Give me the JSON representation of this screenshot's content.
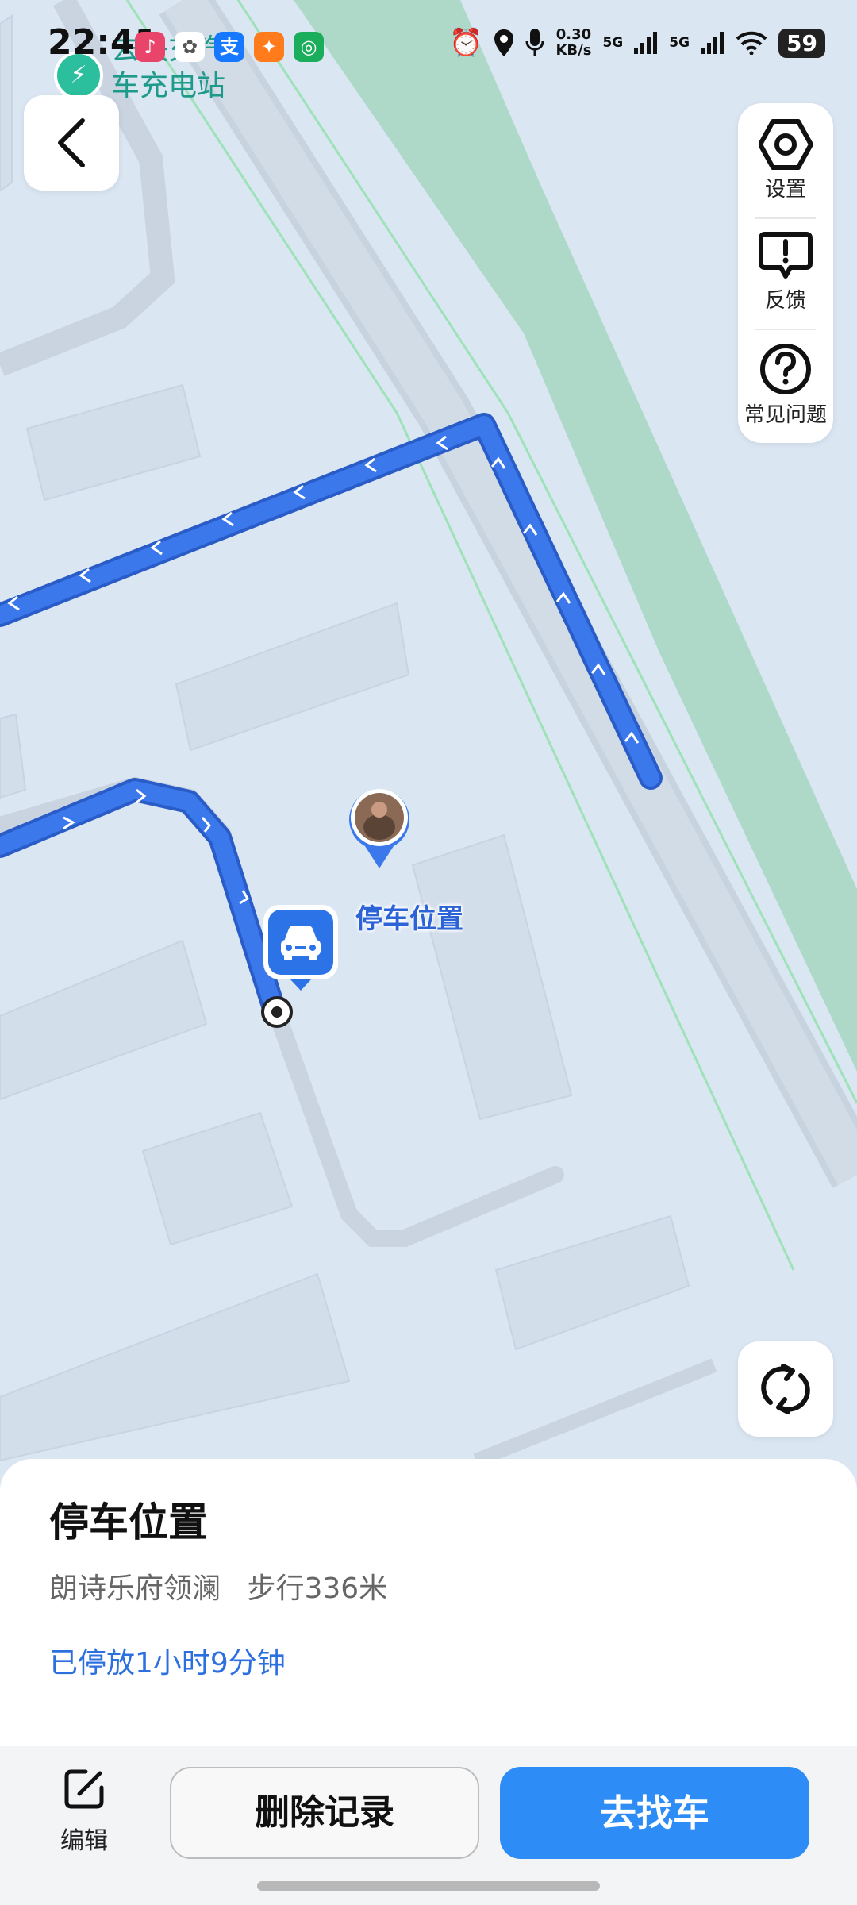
{
  "status_bar": {
    "time": "22:41",
    "net_speed_value": "0.30",
    "net_speed_unit": "KB/s",
    "network_1": "5G",
    "network_2": "5G",
    "battery": "59",
    "app_icons": [
      "music-app-icon",
      "chat-app-icon",
      "alipay-icon",
      "taobao-app-icon",
      "mi-app-icon"
    ]
  },
  "map": {
    "poi_label_line1": "去快充汽",
    "poi_label_line2": "车充电站",
    "parking_label": "停车位置"
  },
  "tools": {
    "settings": "设置",
    "feedback": "反馈",
    "faq": "常见问题"
  },
  "sheet": {
    "title": "停车位置",
    "address": "朗诗乐府领澜",
    "walk_distance": "步行336米",
    "parked_duration": "已停放1小时9分钟"
  },
  "actions": {
    "edit": "编辑",
    "delete": "删除记录",
    "find_car": "去找车"
  },
  "colors": {
    "route": "#3a78ec",
    "accent": "#2d8cf5",
    "map_bg": "#dbe6f3",
    "green_belt": "#aed9c9"
  }
}
